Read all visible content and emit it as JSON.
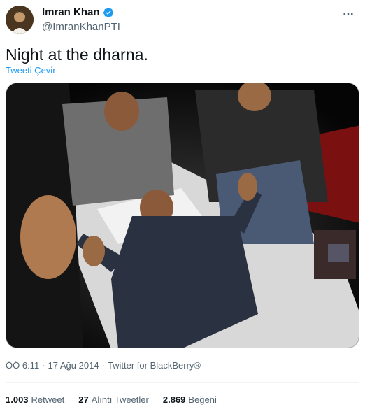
{
  "author": {
    "display_name": "Imran Khan",
    "handle": "@ImranKhanPTI",
    "verified": true,
    "verified_color": "#1d9bf0"
  },
  "tweet": {
    "text": "Night at the dharna.",
    "translate_label": "Tweeti Çevir"
  },
  "meta": {
    "time": "ÖÖ 6:11",
    "separator1": "·",
    "date": "17 Ağu 2014",
    "separator2": "·",
    "source": "Twitter for BlackBerry®"
  },
  "stats": {
    "retweets_count": "1.003",
    "retweets_label": "Retweet",
    "quotes_count": "27",
    "quotes_label": "Alıntı Tweetler",
    "likes_count": "2.869",
    "likes_label": "Beğeni"
  },
  "icons": {
    "more": "more-horizontal-icon",
    "verified": "verified-badge-icon"
  },
  "colors": {
    "link": "#1d9bf0",
    "secondary_text": "#536471",
    "primary_text": "#0f1419"
  }
}
